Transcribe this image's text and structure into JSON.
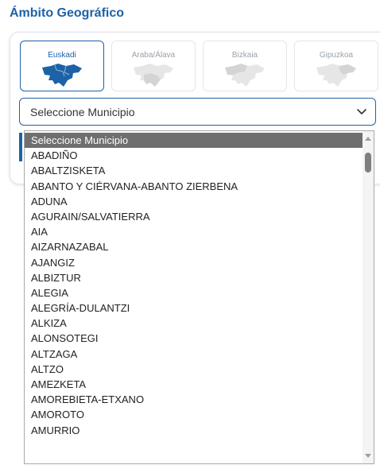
{
  "section": {
    "title": "Ámbito Geográfico"
  },
  "territories": [
    {
      "label": "Euskadi",
      "active": true,
      "map_icon": "euskadi-map-icon",
      "color": "#1d62a5"
    },
    {
      "label": "Araba/Álava",
      "active": false,
      "map_icon": "araba-map-icon",
      "color": "#e6e6e6"
    },
    {
      "label": "Bizkaia",
      "active": false,
      "map_icon": "bizkaia-map-icon",
      "color": "#e6e6e6"
    },
    {
      "label": "Gipuzkoa",
      "active": false,
      "map_icon": "gipuzkoa-map-icon",
      "color": "#e6e6e6"
    }
  ],
  "municipality_select": {
    "selected": "Seleccione Municipio",
    "icon": "chevron-down-icon"
  },
  "municipality_options": [
    "Seleccione Municipio",
    "ABADIÑO",
    "ABALTZISKETA",
    "ABANTO Y CIÉRVANA-ABANTO ZIERBENA",
    "ADUNA",
    "AGURAIN/SALVATIERRA",
    "AIA",
    "AIZARNAZABAL",
    "AJANGIZ",
    "ALBIZTUR",
    "ALEGIA",
    "ALEGRÍA-DULANTZI",
    "ALKIZA",
    "ALONSOTEGI",
    "ALTZAGA",
    "ALTZO",
    "AMEZKETA",
    "AMOREBIETA-ETXANO",
    "AMOROTO",
    "AMURRIO"
  ],
  "colors": {
    "accent": "#1d62a5",
    "selected_row": "#6f6f6f",
    "inactive_map": "#e6e6e6"
  }
}
